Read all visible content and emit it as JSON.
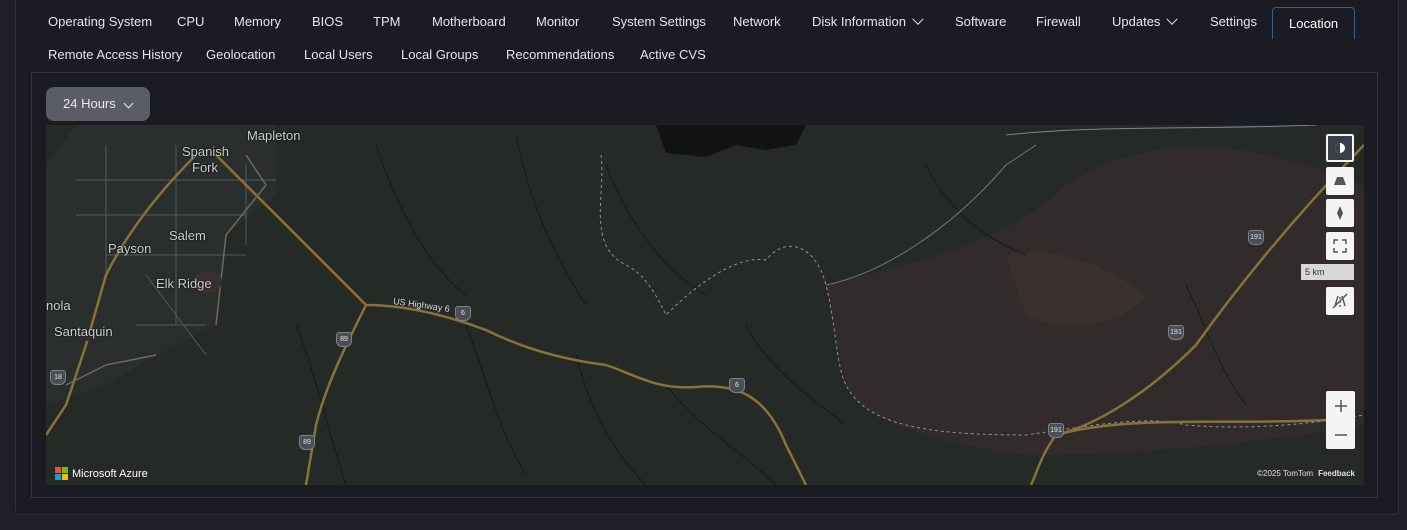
{
  "tabs": {
    "row1": [
      {
        "label": "Operating System",
        "has_dropdown": false
      },
      {
        "label": "CPU",
        "has_dropdown": false
      },
      {
        "label": "Memory",
        "has_dropdown": false
      },
      {
        "label": "BIOS",
        "has_dropdown": false
      },
      {
        "label": "TPM",
        "has_dropdown": false
      },
      {
        "label": "Motherboard",
        "has_dropdown": false
      },
      {
        "label": "Monitor",
        "has_dropdown": false
      },
      {
        "label": "System Settings",
        "has_dropdown": false
      },
      {
        "label": "Network",
        "has_dropdown": false
      },
      {
        "label": "Disk Information",
        "has_dropdown": true
      },
      {
        "label": "Software",
        "has_dropdown": false
      },
      {
        "label": "Firewall",
        "has_dropdown": false
      },
      {
        "label": "Updates",
        "has_dropdown": true
      },
      {
        "label": "Settings",
        "has_dropdown": false
      },
      {
        "label": "Location",
        "has_dropdown": false,
        "active": true
      }
    ],
    "row2": [
      {
        "label": "Remote Access History"
      },
      {
        "label": "Geolocation"
      },
      {
        "label": "Local Users"
      },
      {
        "label": "Local Groups"
      },
      {
        "label": "Recommendations"
      },
      {
        "label": "Active CVS"
      }
    ]
  },
  "time_range": {
    "selected": "24 Hours"
  },
  "map": {
    "places": [
      "Mapleton",
      "Spanish",
      "Fork",
      "Payson",
      "Salem",
      "Elk Ridge",
      "nola",
      "Santaquin"
    ],
    "highway_label": "US Highway 6",
    "shields": [
      "6",
      "89",
      "89",
      "18",
      "6",
      "191",
      "191",
      "191"
    ],
    "scale_label": "5 km",
    "brand": "Microsoft Azure",
    "copyright": "©2025 TomTom",
    "feedback": "Feedback",
    "controls": [
      "style-picker-icon",
      "pitch-icon",
      "compass-icon",
      "fullscreen-icon",
      "traffic-icon"
    ],
    "colors": {
      "land": "#252a27",
      "road": "#8a7236",
      "boundary": "#9aa0a6",
      "reddish": "#3a3030"
    }
  }
}
